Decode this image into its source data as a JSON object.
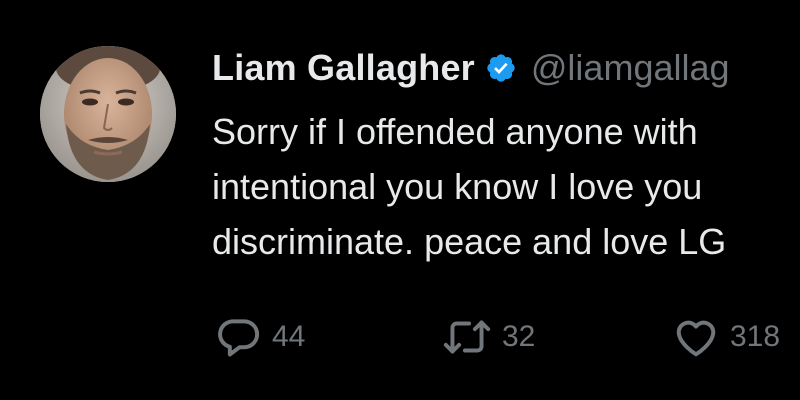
{
  "tweet": {
    "author": {
      "display_name": "Liam Gallagher",
      "handle": "@liamgallag",
      "verified": true,
      "verified_icon": "verified-badge-icon",
      "verified_color": "#1d9bf0"
    },
    "text_lines": [
      "Sorry if I offended anyone with",
      "intentional you know I love you",
      "discriminate. peace and love LG"
    ],
    "actions": {
      "reply": {
        "icon": "reply-icon",
        "count": "44"
      },
      "repost": {
        "icon": "repost-icon",
        "count": "32"
      },
      "like": {
        "icon": "heart-icon",
        "count": "318"
      }
    }
  },
  "colors": {
    "background": "#000000",
    "text": "#e7e9ea",
    "muted": "#71767b",
    "accent": "#1d9bf0"
  }
}
